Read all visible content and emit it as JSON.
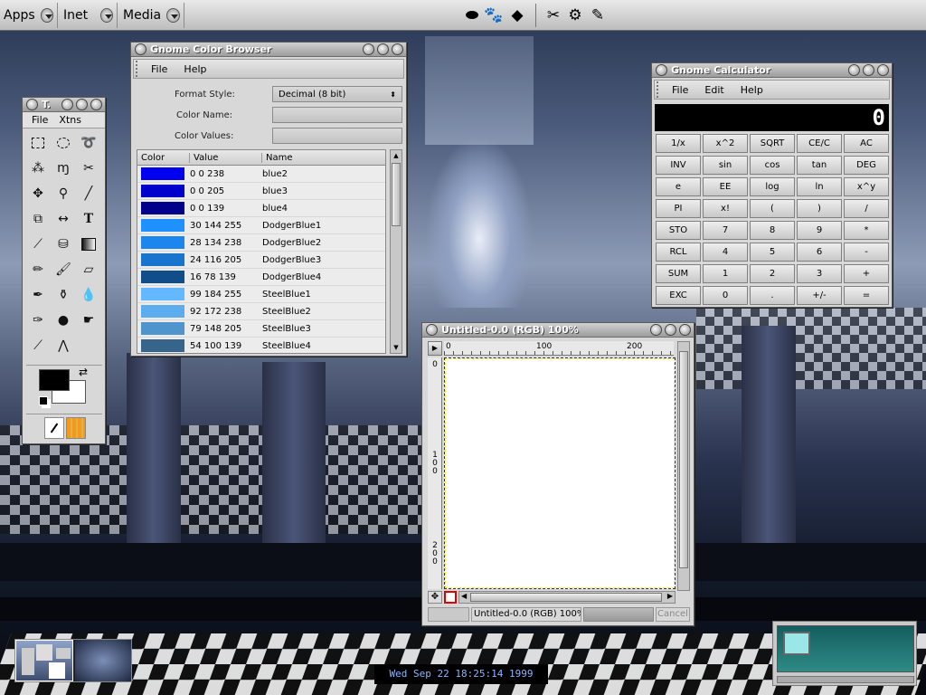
{
  "panel": {
    "menus": [
      "Apps",
      "Inet",
      "Media"
    ],
    "launchers": [
      {
        "icon": "gnome-foot-icon"
      },
      {
        "icon": "gimp-icon"
      },
      {
        "icon": "scanner-icon"
      },
      {
        "icon": "tools-icon"
      },
      {
        "icon": "help-icon"
      },
      {
        "icon": "notes-icon"
      }
    ],
    "clock": "Wed Sep 22 18:25:14 1999"
  },
  "toolbox": {
    "title": "T.",
    "menu": [
      "File",
      "Xtns"
    ]
  },
  "color_browser": {
    "title": "Gnome Color Browser",
    "menu": [
      "File",
      "Help"
    ],
    "format_label": "Format Style:",
    "format_value": "Decimal (8 bit)",
    "name_label": "Color Name:",
    "values_label": "Color Values:",
    "columns": [
      "Color",
      "Value",
      "Name"
    ],
    "rows": [
      {
        "color": "#0000ee",
        "value": "0 0 238",
        "name": "blue2"
      },
      {
        "color": "#0000cd",
        "value": "0 0 205",
        "name": "blue3"
      },
      {
        "color": "#00008b",
        "value": "0 0 139",
        "name": "blue4"
      },
      {
        "color": "#1e90ff",
        "value": "30 144 255",
        "name": "DodgerBlue1"
      },
      {
        "color": "#1c86ee",
        "value": "28 134 238",
        "name": "DodgerBlue2"
      },
      {
        "color": "#1874cd",
        "value": "24 116 205",
        "name": "DodgerBlue3"
      },
      {
        "color": "#104e8b",
        "value": "16 78 139",
        "name": "DodgerBlue4"
      },
      {
        "color": "#63b8ff",
        "value": "99 184 255",
        "name": "SteelBlue1"
      },
      {
        "color": "#5cacee",
        "value": "92 172 238",
        "name": "SteelBlue2"
      },
      {
        "color": "#4f94cd",
        "value": "79 148 205",
        "name": "SteelBlue3"
      },
      {
        "color": "#36648b",
        "value": "54 100 139",
        "name": "SteelBlue4"
      }
    ]
  },
  "calculator": {
    "title": "Gnome Calculator",
    "menu": [
      "File",
      "Edit",
      "Help"
    ],
    "display": "0",
    "keys": [
      [
        "1/x",
        "x^2",
        "SQRT",
        "CE/C",
        "AC"
      ],
      [
        "INV",
        "sin",
        "cos",
        "tan",
        "DEG"
      ],
      [
        "e",
        "EE",
        "log",
        "ln",
        "x^y"
      ],
      [
        "PI",
        "x!",
        "(",
        ")",
        "/"
      ],
      [
        "STO",
        "7",
        "8",
        "9",
        "*"
      ],
      [
        "RCL",
        "4",
        "5",
        "6",
        "-"
      ],
      [
        "SUM",
        "1",
        "2",
        "3",
        "+"
      ],
      [
        "EXC",
        "0",
        ".",
        "+/-",
        "="
      ]
    ]
  },
  "image": {
    "title": "Untitled-0.0 (RGB) 100%",
    "ruler_h": [
      "0",
      "100",
      "200"
    ],
    "ruler_v": [
      "0",
      "1\n0\n0",
      "2\n0\n0"
    ],
    "status": "Untitled-0.0 (RGB) 100%",
    "cancel": "Cancel"
  }
}
